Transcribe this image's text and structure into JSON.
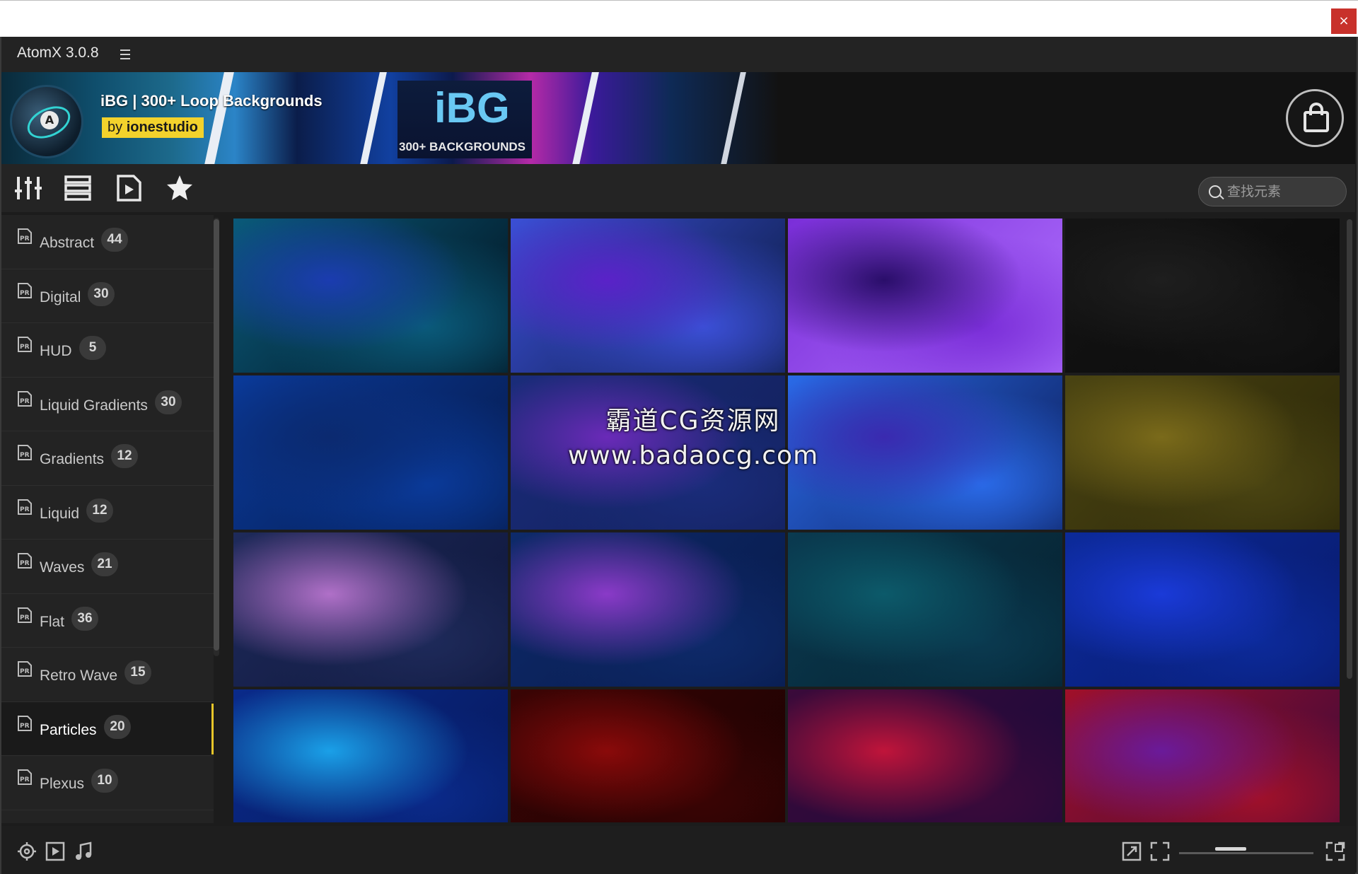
{
  "window": {
    "close_label": "×"
  },
  "app": {
    "title": "AtomX 3.0.8"
  },
  "banner": {
    "title": "iBG | 300+ Loop Backgrounds",
    "by_prefix": "by",
    "author": "ionestudio",
    "brand": "iBG",
    "brand_sub": "300+ BACKGROUNDS"
  },
  "toolbar": {
    "icons": [
      "sliders-icon",
      "list-icon",
      "play-file-icon",
      "star-icon"
    ],
    "search_placeholder": "查找元素"
  },
  "sidebar": {
    "items": [
      {
        "label": "Abstract",
        "count": "44",
        "active": false
      },
      {
        "label": "Digital",
        "count": "30",
        "active": false
      },
      {
        "label": "HUD",
        "count": "5",
        "active": false
      },
      {
        "label": "Liquid Gradients",
        "count": "30",
        "active": false
      },
      {
        "label": "Gradients",
        "count": "12",
        "active": false
      },
      {
        "label": "Liquid",
        "count": "12",
        "active": false
      },
      {
        "label": "Waves",
        "count": "21",
        "active": false
      },
      {
        "label": "Flat",
        "count": "36",
        "active": false
      },
      {
        "label": "Retro Wave",
        "count": "15",
        "active": false
      },
      {
        "label": "Particles",
        "count": "20",
        "active": true
      },
      {
        "label": "Plexus",
        "count": "10",
        "active": false
      }
    ]
  },
  "grid": {
    "thumbnails": [
      {
        "colors": [
          "#0a5a7a",
          "#1b3cb0",
          "#02121e"
        ]
      },
      {
        "colors": [
          "#3b4fd6",
          "#5a22c8",
          "#0a1a40"
        ]
      },
      {
        "colors": [
          "#7a2ed8",
          "#2a0e6a",
          "#b070ff"
        ]
      },
      {
        "colors": [
          "#141414",
          "#1e1e1e",
          "#0a0a0a"
        ]
      },
      {
        "colors": [
          "#0a3a9a",
          "#0b2a70",
          "#061a4a"
        ]
      },
      {
        "colors": [
          "#1a2c7a",
          "#6a2ab8",
          "#12205a"
        ]
      },
      {
        "colors": [
          "#2a6ae8",
          "#3a2ab0",
          "#0c1e5a"
        ]
      },
      {
        "colors": [
          "#4a4412",
          "#7a6a1a",
          "#2a2608"
        ]
      },
      {
        "colors": [
          "#1e2a5a",
          "#b070c8",
          "#0e163a"
        ]
      },
      {
        "colors": [
          "#0e2a6a",
          "#8a3ac8",
          "#081a4a"
        ]
      },
      {
        "colors": [
          "#0a3a50",
          "#0c5a6a",
          "#06202e"
        ]
      },
      {
        "colors": [
          "#0c2a9a",
          "#1a3ad8",
          "#081a6a"
        ]
      },
      {
        "colors": [
          "#0a2a8a",
          "#1aa0e8",
          "#06185a"
        ]
      },
      {
        "colors": [
          "#3a0404",
          "#8a0a0a",
          "#1a0202"
        ]
      },
      {
        "colors": [
          "#3a0a3a",
          "#c0143a",
          "#1a0a3a"
        ]
      },
      {
        "colors": [
          "#a0102a",
          "#6a1a9a",
          "#3a0a3a"
        ]
      }
    ]
  },
  "watermark": {
    "line1": "霸道CG资源网",
    "line2": "www.badaocg.com"
  },
  "bottombar": {
    "icons": [
      "target-icon",
      "play-icon",
      "music-icon",
      "expand-icon",
      "fit-icon",
      "fullscreen-icon"
    ],
    "zoom_level": 0.35
  }
}
